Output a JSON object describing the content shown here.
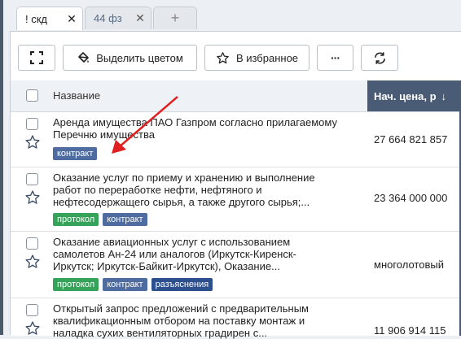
{
  "tabs": [
    {
      "label": "! скд",
      "close": "✕",
      "active": true
    },
    {
      "label": "44 фз",
      "close": "✕",
      "active": false
    }
  ],
  "add_tab": "+",
  "toolbar": {
    "highlight_label": "Выделить цветом",
    "favorite_label": "В избранное",
    "more_label": "···"
  },
  "table": {
    "col_name": "Название",
    "col_price": "Нач. цена, р",
    "sort_indicator": "↓",
    "rows": [
      {
        "title_lines": [
          "Аренда имущества ПАО Газпром согласно прилагаемому",
          "Перечню имущества"
        ],
        "price": "27 664 821 857",
        "badges": [
          {
            "label": "контракт",
            "type": "contract"
          }
        ]
      },
      {
        "title_lines": [
          "Оказание услуг по приему и хранению и выполнение",
          "работ по переработке нефти, нефтяного и",
          "нефтесодержащего сырья, а также другого сырья;..."
        ],
        "price": "23 364 000 000",
        "badges": [
          {
            "label": "протокол",
            "type": "protocol"
          },
          {
            "label": "контракт",
            "type": "contract"
          }
        ]
      },
      {
        "title_lines": [
          "Оказание авиационных услуг с использованием",
          "самолетов Ан-24 или аналогов (Иркутск-Киренск-",
          "Иркутск; Иркутск-Байкит-Иркутск), Оказание..."
        ],
        "price": "многолотовый",
        "badges": [
          {
            "label": "протокол",
            "type": "protocol"
          },
          {
            "label": "контракт",
            "type": "contract"
          },
          {
            "label": "разъяснения",
            "type": "explain"
          }
        ]
      },
      {
        "title_lines": [
          "Открытый запрос предложений с предварительным",
          "квалификационным отбором на поставку монтаж и",
          "наладка сухих вентиляторных градирен с..."
        ],
        "price": "11 906 914 115",
        "badges": []
      }
    ]
  },
  "colors": {
    "header_sort_bg": "#4a5c75",
    "badge_protocol": "#35a35a",
    "badge_contract": "#4f6ca0",
    "badge_explain": "#2e4f8e",
    "arrow": "#e02020"
  },
  "icons": [
    "expand-icon",
    "paint-bucket-icon",
    "star-icon",
    "refresh-icon",
    "close-icon",
    "plus-icon",
    "sort-down-icon"
  ]
}
